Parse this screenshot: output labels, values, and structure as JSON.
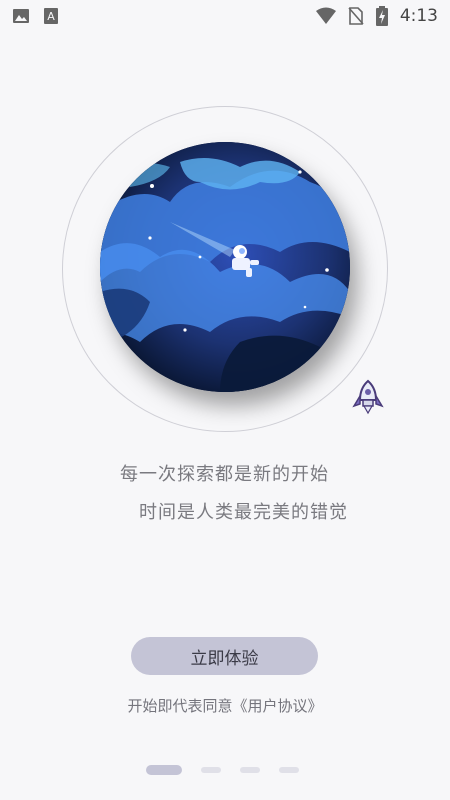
{
  "status_bar": {
    "time": "4:13",
    "left_icons": [
      "image-icon",
      "text-a-icon"
    ],
    "right_icons": [
      "wifi-icon",
      "no-sim-icon",
      "battery-charging-icon"
    ]
  },
  "hero": {
    "image": "space-planet-astronaut-illustration",
    "rocket_icon": "rocket-icon"
  },
  "taglines": {
    "line1": "每一次探索都是新的开始",
    "line2": "时间是人类最完美的错觉"
  },
  "cta": {
    "label": "立即体验"
  },
  "agreement": {
    "text": "开始即代表同意《用户协议》"
  },
  "pager": {
    "count": 4,
    "active_index": 0
  },
  "colors": {
    "background": "#f7f7f9",
    "button": "#c4c4d6",
    "text": "#7a7a80"
  }
}
